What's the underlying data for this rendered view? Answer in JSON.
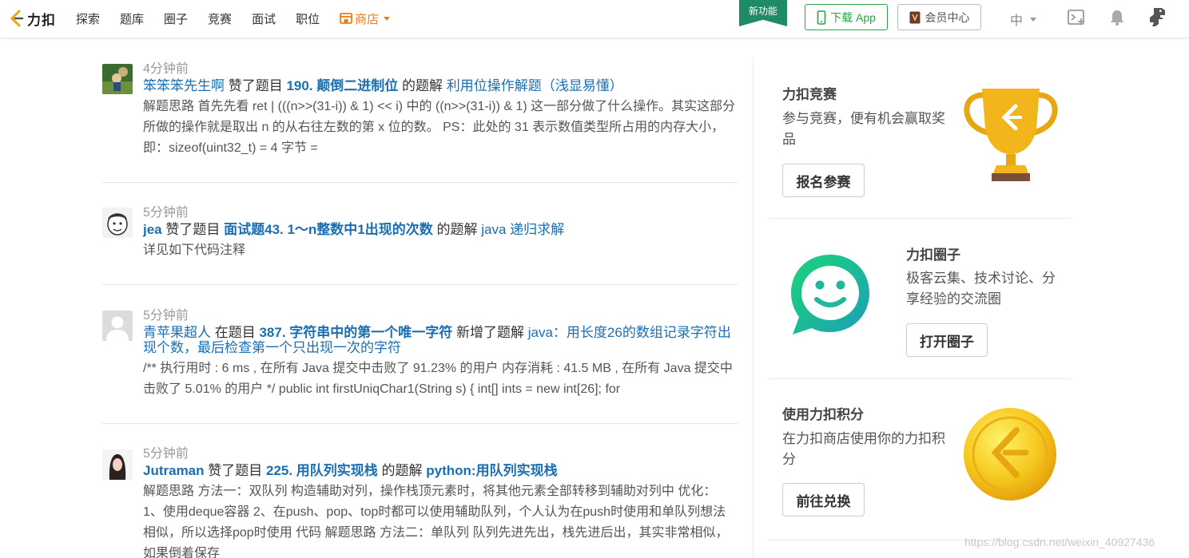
{
  "brand": {
    "name": "力扣",
    "accent": "#f37a12",
    "link": "#1a6fb4"
  },
  "nav": {
    "links": [
      "探索",
      "题库",
      "圈子",
      "竞赛",
      "面试",
      "职位"
    ],
    "shop_label": "商店",
    "new_badge": "新功能",
    "download_label": "下载 App",
    "vip_label": "会员中心",
    "lang_label": "中"
  },
  "feed": [
    {
      "time": "4分钟前",
      "user": "笨笨笨先生啊",
      "action": "赞了题目",
      "problem": "190. 颠倒二进制位",
      "mid": "的题解",
      "solution": "利用位操作解题（浅显易懂）",
      "summary": "解题思路 首先先看 ret | (((n>>(31-i)) & 1) << i) 中的 ((n>>(31-i)) & 1) 这一部分做了什么操作。其实这部分所做的操作就是取出 n 的从右往左数的第 x 位的数。 PS：此处的 31 表示数值类型所占用的内存大小，即：sizeof(uint32_t) = 4 字节 ="
    },
    {
      "time": "5分钟前",
      "user": "jea",
      "action": "赞了题目",
      "problem": "面试题43. 1～n整数中1出现的次数",
      "mid": "的题解",
      "solution": "java 递归求解",
      "summary": "详见如下代码注释"
    },
    {
      "time": "5分钟前",
      "user": "青苹果超人",
      "action": "在题目",
      "problem": "387. 字符串中的第一个唯一字符",
      "mid": "新增了题解",
      "solution": "java：用长度26的数组记录字符出现个数，最后检查第一个只出现一次的字符",
      "summary": "/** 执行用时 : 6 ms , 在所有 Java 提交中击败了 91.23% 的用户 内存消耗 : 41.5 MB , 在所有 Java 提交中击败了 5.01% 的用户 */ public int firstUniqChar1(String s) { int[] ints = new int[26]; for"
    },
    {
      "time": "5分钟前",
      "user": "Jutraman",
      "action": "赞了题目",
      "problem": "225. 用队列实现栈",
      "mid": "的题解",
      "solution": "python:用队列实现栈",
      "summary": "解题思路 方法一：双队列 构造辅助对列，操作栈顶元素时，将其他元素全部转移到辅助对列中 优化： 1、使用deque容器 2、在push、pop、top时都可以使用辅助队列，个人认为在push时使用和单队列想法相似，所以选择pop时使用 代码 解题思路 方法二：单队列 队列先进先出，栈先进后出，其实非常相似，如果倒着保存"
    }
  ],
  "sidebar": {
    "contest": {
      "title": "力扣竞赛",
      "desc": "参与竞赛，便有机会赢取奖品",
      "button": "报名参赛"
    },
    "circle": {
      "title": "力扣圈子",
      "desc": "极客云集、技术讨论、分享经验的交流圈",
      "button": "打开圈子"
    },
    "points": {
      "title": "使用力扣积分",
      "desc": "在力扣商店使用你的力扣积分",
      "button": "前往兑换"
    }
  },
  "watermark": "https://blog.csdn.net/weixin_40927436"
}
